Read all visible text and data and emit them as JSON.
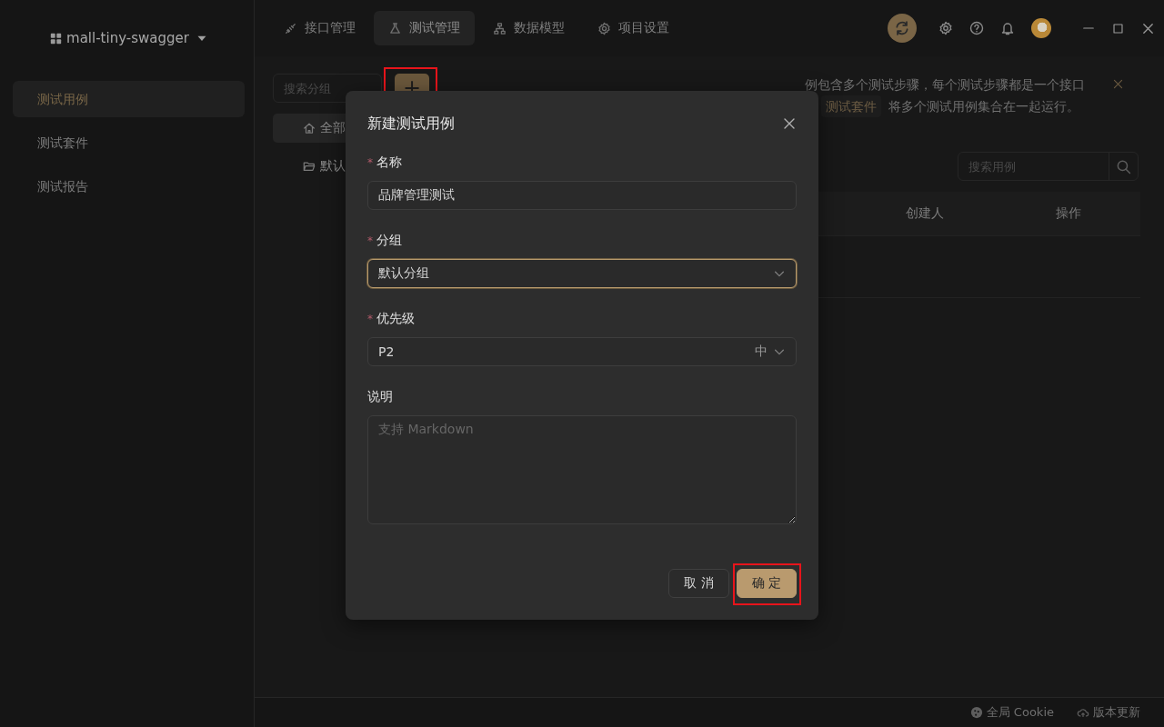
{
  "sidebar": {
    "project": {
      "name": "mall-tiny-swagger"
    },
    "items": [
      {
        "label": "测试用例",
        "selected": true
      },
      {
        "label": "测试套件",
        "selected": false
      },
      {
        "label": "测试报告",
        "selected": false
      }
    ]
  },
  "top_nav": {
    "tabs": [
      {
        "label": "接口管理",
        "selected": false
      },
      {
        "label": "测试管理",
        "selected": true
      },
      {
        "label": "数据模型",
        "selected": false
      },
      {
        "label": "项目设置",
        "selected": false
      }
    ]
  },
  "groups_panel": {
    "search": {
      "placeholder": "搜索分组"
    },
    "add_button": {
      "label": "+",
      "highlighted": true
    },
    "tree": [
      {
        "label": "全部",
        "selected": true
      },
      {
        "label": "默认",
        "selected": false
      }
    ]
  },
  "notice": {
    "line_1": "例包含多个测试步骤，每个测试步骤都是一个接口",
    "tag": "测试套件",
    "line_2": "将多个测试用例集合在一起运行。"
  },
  "cases_panel": {
    "search": {
      "placeholder": "搜索用例"
    },
    "table": {
      "columns": [
        "创建人",
        "操作"
      ]
    }
  },
  "status_bar": {
    "items": [
      {
        "label": "全局 Cookie"
      },
      {
        "label": "版本更新"
      }
    ]
  },
  "dialog": {
    "title": "新建测试用例",
    "required_mark": "*",
    "fields": [
      {
        "kind": "text",
        "label": "名称",
        "required": true,
        "value": "品牌管理测试",
        "focused": false
      },
      {
        "kind": "select",
        "label": "分组",
        "required": true,
        "value": "默认分组",
        "focused": true
      },
      {
        "kind": "select",
        "label": "优先级",
        "required": true,
        "value": "P2",
        "suffix": "中",
        "focused": false
      },
      {
        "kind": "textarea",
        "label": "说明",
        "required": false,
        "placeholder": "支持 Markdown",
        "focused": false
      }
    ],
    "buttons": [
      {
        "label": "取 消",
        "kind": "secondary",
        "highlighted": false
      },
      {
        "label": "确 定",
        "kind": "primary",
        "highlighted": true
      }
    ]
  }
}
